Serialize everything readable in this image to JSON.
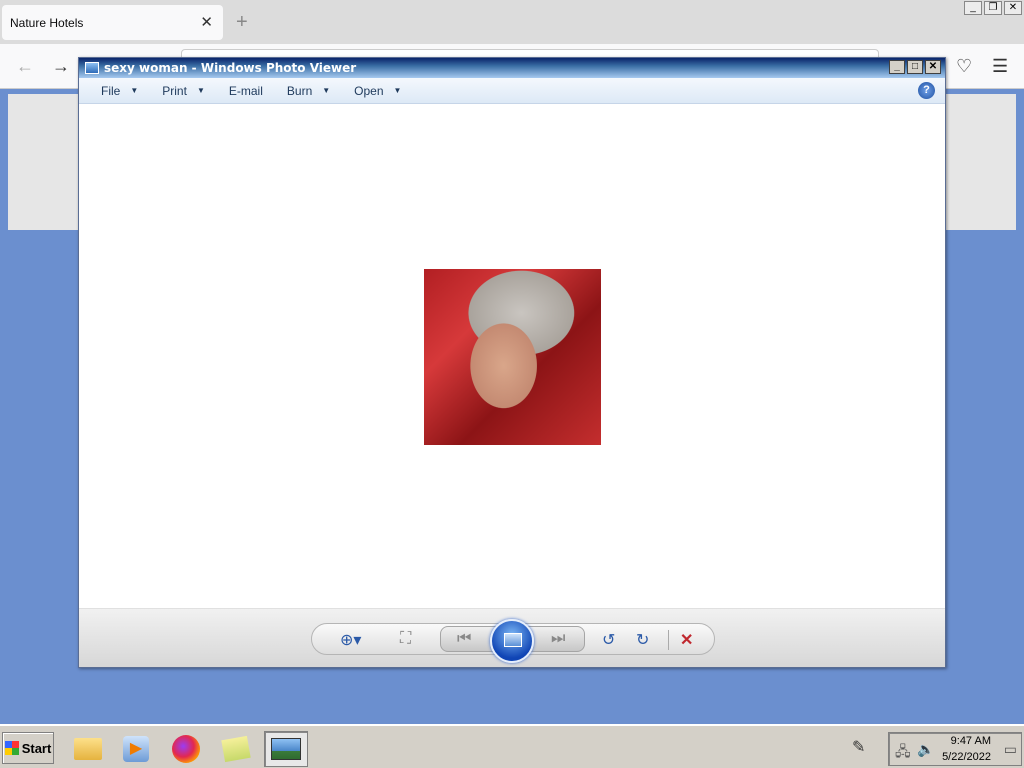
{
  "browser": {
    "tab_title": "Nature Hotels",
    "tab_close": "✕",
    "new_tab": "+",
    "back": "←",
    "forward": "→",
    "window_buttons": [
      "_",
      "❐",
      "✕"
    ]
  },
  "viewer": {
    "title": "sexy woman - Windows Photo Viewer",
    "title_buttons": [
      "_",
      "□",
      "✕"
    ],
    "menu": [
      {
        "label": "File",
        "has_dropdown": true
      },
      {
        "label": "Print",
        "has_dropdown": true
      },
      {
        "label": "E-mail",
        "has_dropdown": false
      },
      {
        "label": "Burn",
        "has_dropdown": true
      },
      {
        "label": "Open",
        "has_dropdown": true
      }
    ],
    "help": "?",
    "controls": {
      "zoom": "⊕▾",
      "fit": "⛶",
      "previous": "⏮",
      "next": "⏭",
      "rotate_ccw": "↺",
      "rotate_cw": "↻",
      "delete": "✕"
    }
  },
  "taskbar": {
    "start_label": "Start",
    "items": [
      "folder-icon",
      "media-player-icon",
      "firefox-icon",
      "files-icon",
      "photo-viewer-icon"
    ],
    "clock_time": "9:47 AM",
    "clock_date": "5/22/2022"
  }
}
